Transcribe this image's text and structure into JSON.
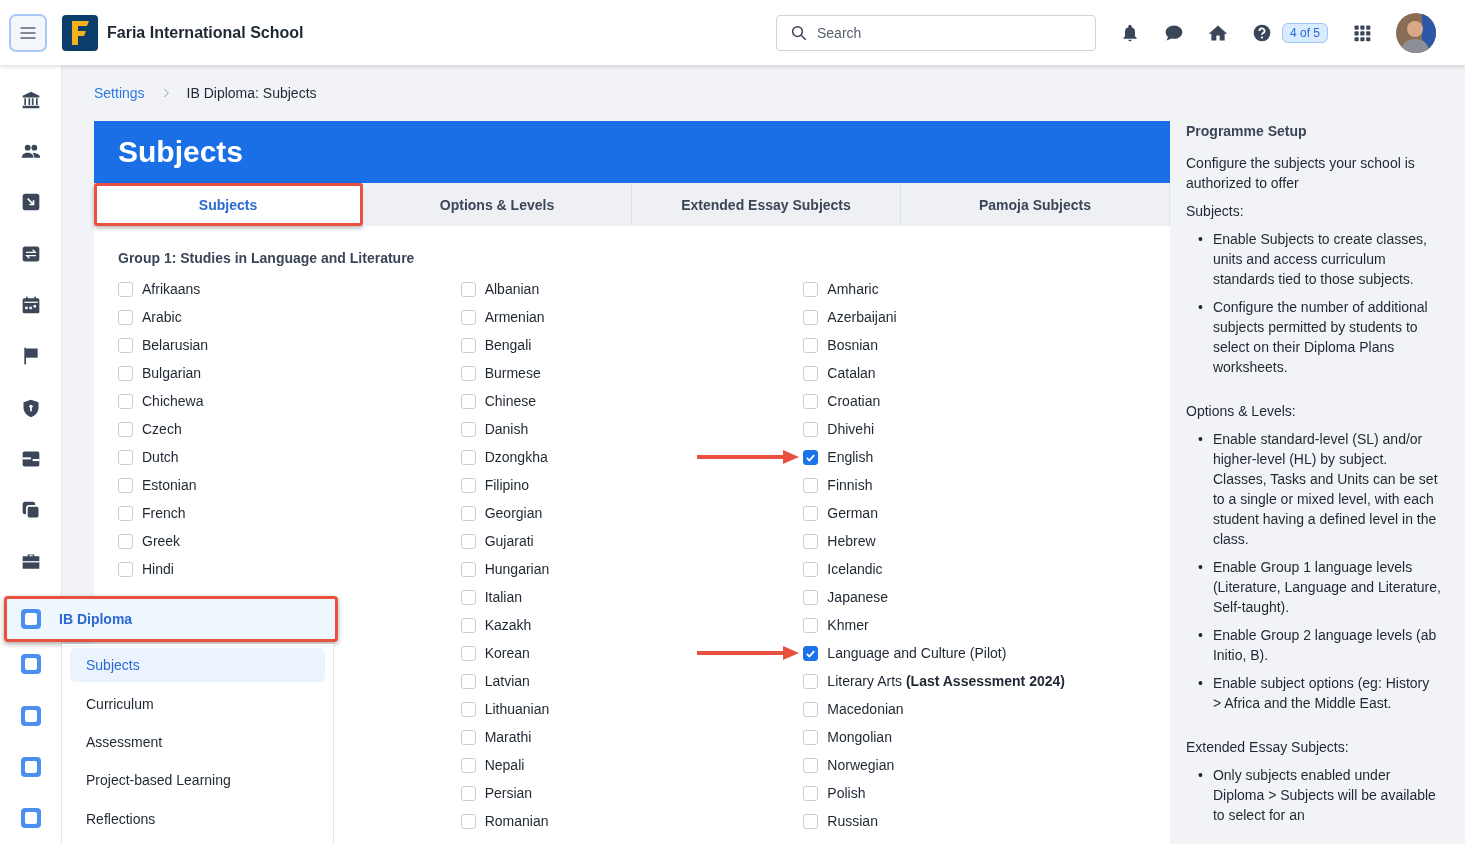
{
  "header": {
    "title": "Faria International School",
    "search": {
      "placeholder": "Search"
    },
    "badge": "4 of 5"
  },
  "breadcrumb": [
    {
      "label": "Settings",
      "kind": "link"
    },
    {
      "label": "IB Diploma: Subjects",
      "kind": "current"
    }
  ],
  "card": {
    "title": "Subjects",
    "tabs": [
      {
        "label": "Subjects",
        "selected": true,
        "highlighted": true
      },
      {
        "label": "Options & Levels",
        "selected": false,
        "highlighted": false
      },
      {
        "label": "Extended Essay Subjects",
        "selected": false,
        "highlighted": false
      },
      {
        "label": "Pamoja Subjects",
        "selected": false,
        "highlighted": false
      }
    ],
    "group": {
      "title": "Group 1: Studies in Language and Literature",
      "columns": [
        [
          {
            "label": "Afrikaans",
            "checked": false
          },
          {
            "label": "Arabic",
            "checked": false
          },
          {
            "label": "Belarusian",
            "checked": false
          },
          {
            "label": "Bulgarian",
            "checked": false
          },
          {
            "label": "Chichewa",
            "checked": false
          },
          {
            "label": "Czech",
            "checked": false
          },
          {
            "label": "Dutch",
            "checked": false
          },
          {
            "label": "Estonian",
            "checked": false
          },
          {
            "label": "French",
            "checked": false
          },
          {
            "label": "Greek",
            "checked": false
          },
          {
            "label": "Hindi",
            "checked": false
          }
        ],
        [
          {
            "label": "Albanian",
            "checked": false
          },
          {
            "label": "Armenian",
            "checked": false
          },
          {
            "label": "Bengali",
            "checked": false
          },
          {
            "label": "Burmese",
            "checked": false
          },
          {
            "label": "Chinese",
            "checked": false
          },
          {
            "label": "Danish",
            "checked": false
          },
          {
            "label": "Dzongkha",
            "checked": false
          },
          {
            "label": "Filipino",
            "checked": false
          },
          {
            "label": "Georgian",
            "checked": false
          },
          {
            "label": "Gujarati",
            "checked": false
          },
          {
            "label": "Hungarian",
            "checked": false
          },
          {
            "label": "Italian",
            "checked": false
          },
          {
            "label": "Kazakh",
            "checked": false
          },
          {
            "label": "Korean",
            "checked": false
          },
          {
            "label": "Latvian",
            "checked": false
          },
          {
            "label": "Lithuanian",
            "checked": false
          },
          {
            "label": "Marathi",
            "checked": false
          },
          {
            "label": "Nepali",
            "checked": false
          },
          {
            "label": "Persian",
            "checked": false
          },
          {
            "label": "Romanian",
            "checked": false
          }
        ],
        [
          {
            "label": "Amharic",
            "checked": false
          },
          {
            "label": "Azerbaijani",
            "checked": false
          },
          {
            "label": "Bosnian",
            "checked": false
          },
          {
            "label": "Catalan",
            "checked": false
          },
          {
            "label": "Croatian",
            "checked": false
          },
          {
            "label": "Dhivehi",
            "checked": false
          },
          {
            "label": "English",
            "checked": true,
            "arrow": true
          },
          {
            "label": "Finnish",
            "checked": false
          },
          {
            "label": "German",
            "checked": false
          },
          {
            "label": "Hebrew",
            "checked": false
          },
          {
            "label": "Icelandic",
            "checked": false
          },
          {
            "label": "Japanese",
            "checked": false
          },
          {
            "label": "Khmer",
            "checked": false
          },
          {
            "label": "Language and Culture (Pilot)",
            "checked": true,
            "arrow": true
          },
          {
            "label": "Literary Arts **(Last Assessment 2024)**",
            "checked": false
          },
          {
            "label": "Macedonian",
            "checked": false
          },
          {
            "label": "Mongolian",
            "checked": false
          },
          {
            "label": "Norwegian",
            "checked": false
          },
          {
            "label": "Polish",
            "checked": false
          },
          {
            "label": "Russian",
            "checked": false
          }
        ]
      ]
    }
  },
  "flyout": {
    "item": {
      "label": "IB Diploma",
      "highlighted": true
    },
    "items": [
      {
        "label": "Subjects",
        "selected": true
      },
      {
        "label": "Curriculum",
        "selected": false
      },
      {
        "label": "Assessment",
        "selected": false
      },
      {
        "label": "Project-based Learning",
        "selected": false
      },
      {
        "label": "Reflections",
        "selected": false
      }
    ]
  },
  "help_panel": {
    "title": "Programme Setup",
    "intro": "Configure the subjects your school is authorized to offer",
    "sections": [
      {
        "heading": "Subjects:",
        "bullets": [
          {
            "marker": "•",
            "text": "Enable Subjects to create classes, units and access curriculum standards tied to those subjects."
          },
          {
            "marker": "•",
            "text": "Configure the number of additional subjects permitted by students to select on their Diploma Plans worksheets."
          }
        ]
      },
      {
        "heading": "Options & Levels:",
        "bullets": [
          {
            "marker": "•",
            "text": "Enable standard-level (SL) and/or higher-level (HL) by subject. Classes, Tasks and Units can be set to a single or mixed level, with each student having a defined level in the class."
          },
          {
            "marker": "•",
            "text": "Enable Group 1 language levels (Literature, Language and Literature, Self-taught)."
          },
          {
            "marker": "•",
            "text": "Enable Group 2 language levels (ab Initio, B)."
          },
          {
            "marker": "•",
            "text": "Enable subject options (eg: History > Africa and the Middle East."
          }
        ]
      },
      {
        "heading": "Extended Essay Subjects:",
        "bullets": [
          {
            "marker": "•",
            "text": "Only subjects enabled under Diploma > Subjects will be available to select for an"
          }
        ]
      }
    ]
  }
}
